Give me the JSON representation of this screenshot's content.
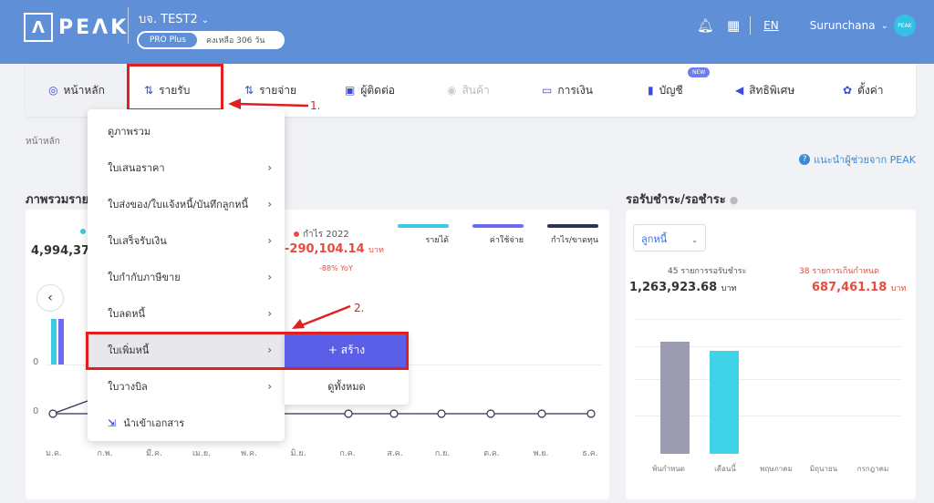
{
  "header": {
    "logo_mark": "Λ",
    "logo_text": "PEΛK",
    "company": "บจ. TEST2",
    "plan_badge": "PRO Plus",
    "plan_remaining": "คงเหลือ 306 วัน",
    "lang": "EN",
    "user": "Surunchana",
    "avatar_text": "PEAK"
  },
  "nav": {
    "home": "หน้าหลัก",
    "income": "รายรับ",
    "expense": "รายจ่าย",
    "contacts": "ผู้ติดต่อ",
    "products": "สินค้า",
    "finance": "การเงิน",
    "accounting": "บัญชี",
    "accounting_badge": "NEW",
    "privileges": "สิทธิพิเศษ",
    "settings": "ตั้งค่า"
  },
  "annotations": {
    "step1": "1.",
    "step2": "2."
  },
  "breadcrumb": "หน้าหลัก",
  "helper_link": "แนะนำผู้ช่วยจาก PEAK",
  "overview": {
    "title": "ภาพรวมรายได้",
    "total": "4,994,37",
    "profit_label": "กำไร 2022",
    "profit_value": "-290,104.14",
    "profit_unit": "บาท",
    "profit_yoy": "-88% YoY",
    "legend": [
      {
        "label": "รายได้",
        "color": "#3ec8e8"
      },
      {
        "label": "ค่าใช้จ่าย",
        "color": "#6c6cf0"
      },
      {
        "label": "กำไร/ขาดทุน",
        "color": "#2d3250"
      }
    ],
    "zero": "0",
    "months": [
      "ม.ค.",
      "ก.พ.",
      "มี.ค.",
      "เม.ย.",
      "พ.ค.",
      "มิ.ย.",
      "ก.ค.",
      "ส.ค.",
      "ก.ย.",
      "ต.ค.",
      "พ.ย.",
      "ธ.ค."
    ]
  },
  "menu": {
    "items": [
      {
        "label": "ดูภาพรวม",
        "arrow": ""
      },
      {
        "label": "ใบเสนอราคา",
        "arrow": "›"
      },
      {
        "label": "ใบส่งของ/ใบแจ้งหนี้/บันทึกลูกหนี้",
        "arrow": "›"
      },
      {
        "label": "ใบเสร็จรับเงิน",
        "arrow": "›"
      },
      {
        "label": "ใบกำกับภาษีขาย",
        "arrow": "›"
      },
      {
        "label": "ใบลดหนี้",
        "arrow": "›"
      },
      {
        "label": "ใบเพิ่มหนี้",
        "arrow": "›"
      },
      {
        "label": "ใบวางบิล",
        "arrow": "›"
      },
      {
        "label": "นำเข้าเอกสาร",
        "arrow": ""
      }
    ],
    "submenu_create": "+ สร้าง",
    "submenu_all": "ดูทั้งหมด"
  },
  "receivables": {
    "title": "รอรับชำระ/รอชำระ",
    "select_value": "ลูกหนี้",
    "pending_label": "45 รายการรอรับชำระ",
    "pending_value": "1,263,923.68",
    "overdue_label": "38 รายการเกินกำหนด",
    "overdue_value": "687,461.18",
    "unit": "บาท",
    "categories": [
      "พ้นกำหนด",
      "เดือนนี้",
      "พฤษภาคม",
      "มิถุนายน",
      "กรกฎาคม"
    ]
  },
  "chart_data": {
    "type": "bar",
    "categories": [
      "พ้นกำหนด",
      "เดือนนี้",
      "พฤษภาคม",
      "มิถุนายน",
      "กรกฎาคม"
    ],
    "values": [
      0.98,
      0.9,
      0,
      0,
      0
    ],
    "colors": [
      "#9b9cb0",
      "#3ed3e6",
      "#3ed3e6",
      "#3ed3e6",
      "#3ed3e6"
    ],
    "grid": true
  }
}
